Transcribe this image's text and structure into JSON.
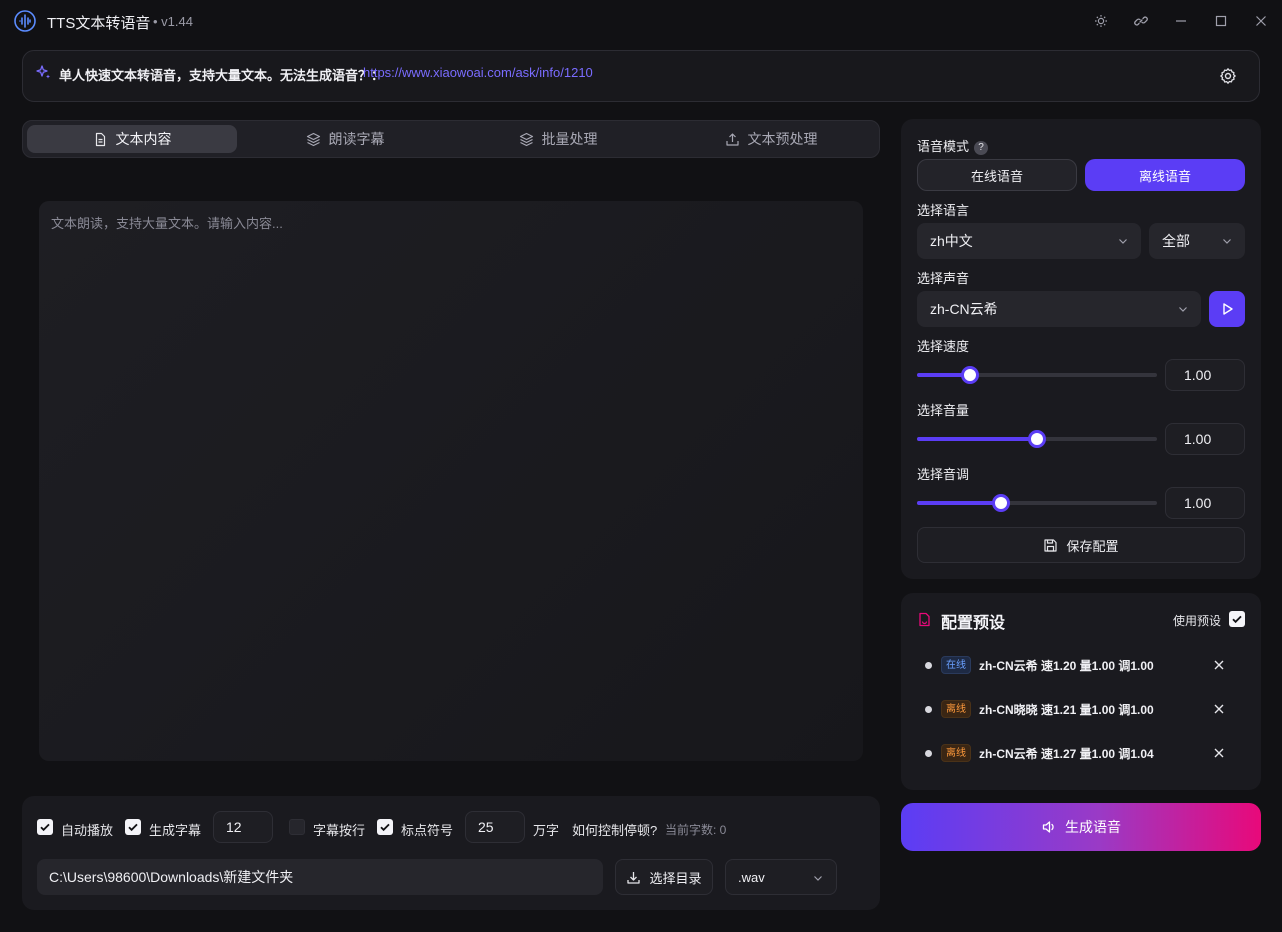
{
  "window": {
    "title": "TTS文本转语音",
    "version": "v1.44"
  },
  "notice": {
    "text": "单人快速文本转语音，支持大量文本。无法生成语音？：",
    "link": "https://www.xiaowoai.com/ask/info/1210"
  },
  "tabs": [
    {
      "label": "文本内容",
      "active": true
    },
    {
      "label": "朗读字幕",
      "active": false
    },
    {
      "label": "批量处理",
      "active": false
    },
    {
      "label": "文本预处理",
      "active": false
    }
  ],
  "editor": {
    "placeholder": "文本朗读，支持大量文本。请输入内容..."
  },
  "options": {
    "autoplay_label": "自动播放",
    "autoplay": true,
    "subtitle_label": "生成字幕",
    "subtitle": true,
    "subtitle_value": "12",
    "wrap_label": "字幕按行",
    "wrap": false,
    "punct_label": "标点符号",
    "punct": true,
    "limit_value": "25",
    "limit_unit": "万字",
    "pause_help": "如何控制停顿?",
    "char_count": "当前字数: 0"
  },
  "output": {
    "path": "C:\\Users\\98600\\Downloads\\新建文件夹",
    "choose_dir_label": "选择目录",
    "format": ".wav"
  },
  "settings": {
    "mode_label": "语音模式",
    "mode_help": "?",
    "online_label": "在线语音",
    "offline_label": "离线语音",
    "active_mode": "offline",
    "language_label": "选择语言",
    "language": "zh中文",
    "language_filter": "全部",
    "voice_label": "选择声音",
    "voice": "zh-CN云希",
    "speed_label": "选择速度",
    "speed_value": "1.00",
    "speed_fraction": 0.22,
    "volume_label": "选择音量",
    "volume_value": "1.00",
    "volume_fraction": 0.5,
    "pitch_label": "选择音调",
    "pitch_value": "1.00",
    "pitch_fraction": 0.35,
    "save_label": "保存配置"
  },
  "presets": {
    "title": "配置预设",
    "use_label": "使用预设",
    "use": true,
    "items": [
      {
        "tag": "在线",
        "type": "online",
        "text": "zh-CN云希 速1.20 量1.00 调1.00"
      },
      {
        "tag": "离线",
        "type": "offline",
        "text": "zh-CN晓晓 速1.21 量1.00 调1.00"
      },
      {
        "tag": "离线",
        "type": "offline",
        "text": "zh-CN云希 速1.27 量1.00 调1.04"
      }
    ]
  },
  "generate_label": "生成语音",
  "colors": {
    "accent": "#5b3df5",
    "gradient_end": "#e8097a",
    "background": "#111114"
  }
}
